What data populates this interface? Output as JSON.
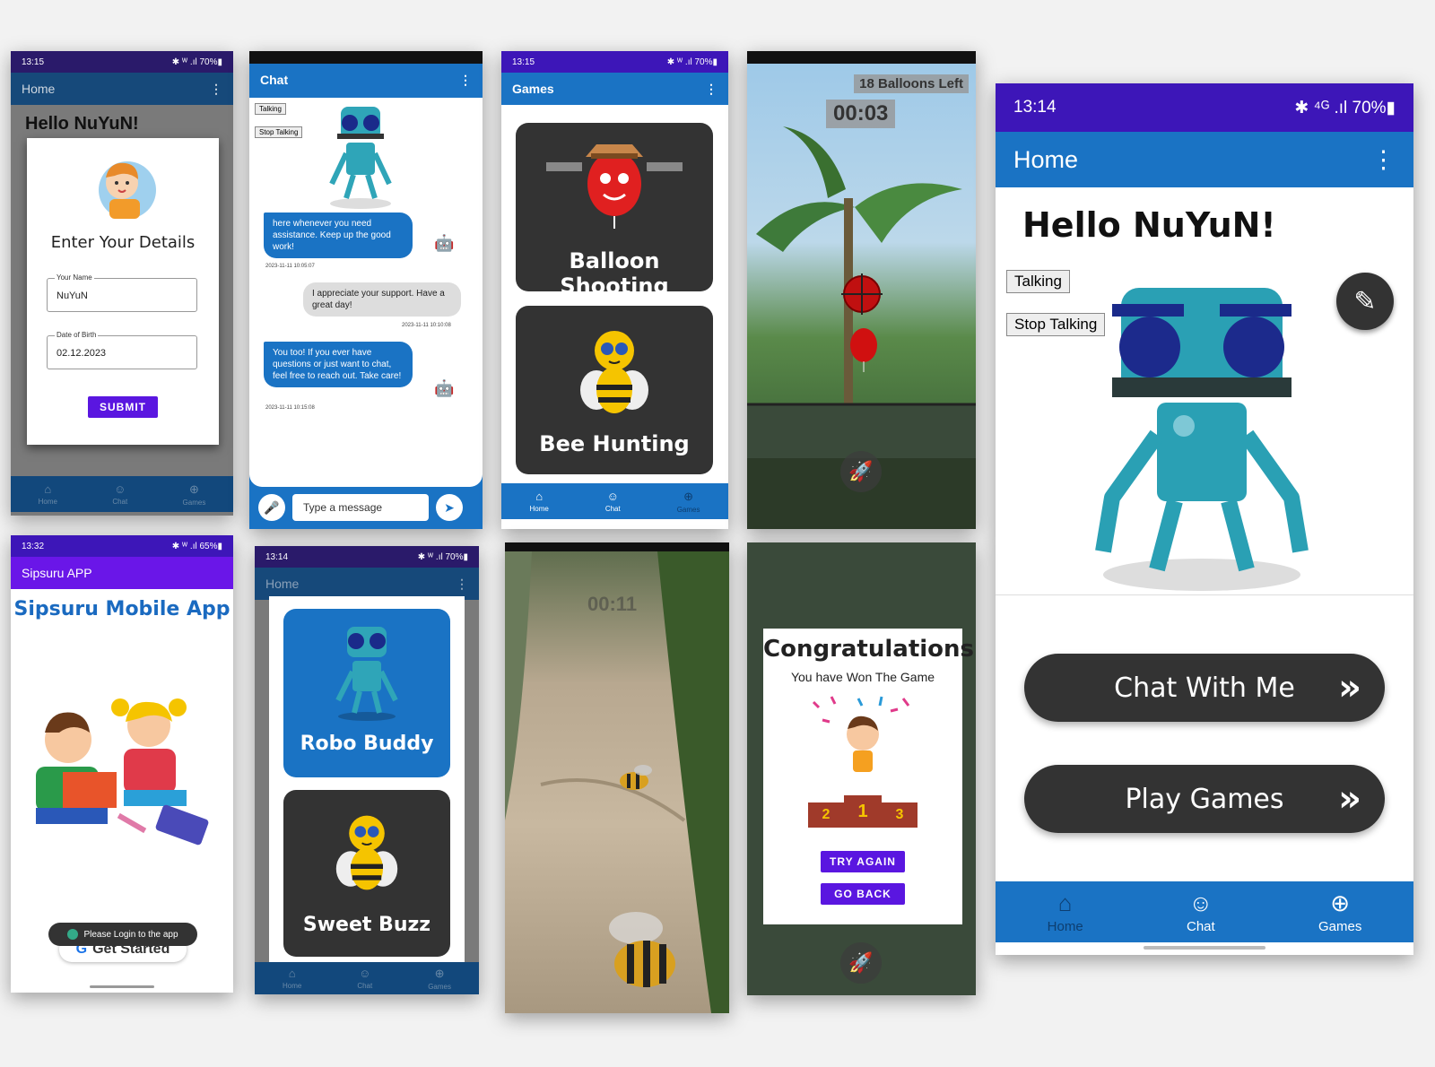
{
  "status": {
    "s1_time": "13:15",
    "s1_right": "✱ ᵂ .ıl 70%▮",
    "s3_time": "13:15",
    "s3_right": "✱ ᵂ .ıl 70%▮",
    "s5_time": "13:14",
    "s5_right": "✱ ⁴ᴳ .ıl 70%▮",
    "s6_time": "13:32",
    "s6_right": "✱ ᵂ .ıl 65%▮",
    "s7_time": "13:14",
    "s7_right": "✱ ᵂ .ıl 70%▮"
  },
  "details_screen": {
    "appbar_title": "Home",
    "greeting": "Hello NuYuN!",
    "dialog_title": "Enter Your Details",
    "name_label": "Your Name",
    "name_value": "NuYuN",
    "dob_label": "Date of Birth",
    "dob_value": "02.12.2023",
    "submit": "SUBMIT",
    "nav": [
      "Home",
      "Chat",
      "Games"
    ]
  },
  "chat_screen": {
    "appbar_title": "Chat",
    "chip_talking": "Talking",
    "chip_stop": "Stop Talking",
    "messages": [
      {
        "from": "bot",
        "text": "here whenever you need assistance. Keep up the good work!",
        "time": "2023-11-11 10:05:07"
      },
      {
        "from": "user",
        "text": "I appreciate your support. Have a great day!",
        "time": "2023-11-11 10:10:08"
      },
      {
        "from": "bot",
        "text": "You too! If you ever have questions or just want to chat, feel free to reach out. Take care!",
        "time": "2023-11-11 10:15:08"
      }
    ],
    "input_placeholder": "Type a message",
    "nav": [
      "Home",
      "Chat",
      "Games"
    ]
  },
  "games_screen": {
    "appbar_title": "Games",
    "games": [
      "Balloon Shooting",
      "Bee Hunting"
    ],
    "nav": [
      "Home",
      "Chat",
      "Games"
    ]
  },
  "balloon_game": {
    "balloons_left": "18 Balloons Left",
    "timer": "00:03"
  },
  "home_screen": {
    "appbar_title": "Home",
    "greeting": "Hello NuYuN!",
    "chip_talking": "Talking",
    "chip_stop": "Stop Talking",
    "chat_button": "Chat With Me",
    "play_button": "Play Games",
    "nav": [
      "Home",
      "Chat",
      "Games"
    ]
  },
  "login_screen": {
    "appbar_title": "Sipsuru APP",
    "headline": "Sipsuru Mobile App",
    "toast": "Please Login to the app",
    "get_started": "Get Started"
  },
  "robo_home": {
    "appbar_title": "Home",
    "cards": [
      "Robo Buddy",
      "Sweet Buzz"
    ],
    "nav": [
      "Home",
      "Chat",
      "Games"
    ]
  },
  "bee_game": {
    "timer": "00:11"
  },
  "win_dialog": {
    "title": "Congratulations!",
    "subtitle": "You have Won The Game",
    "podium": [
      "2",
      "1",
      "3"
    ],
    "try_again": "TRY AGAIN",
    "go_back": "GO BACK"
  },
  "colors": {
    "app_blue": "#1a73c4",
    "status_purple": "#3d16b8",
    "card_dark": "#333333",
    "button_purple": "#5a16e0"
  }
}
